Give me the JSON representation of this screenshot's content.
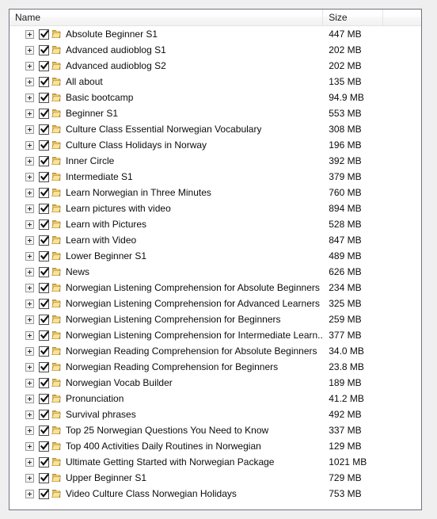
{
  "window": {
    "kind": "file-list-view",
    "accent_folder_color": "#e8c35a",
    "border_color": "#6f7480",
    "background_color": "#efefef",
    "row_background_color": "#ffffff",
    "text_color": "#0c0c0c"
  },
  "columns": [
    {
      "key": "name",
      "label": "Name"
    },
    {
      "key": "size",
      "label": "Size"
    },
    {
      "key": "pad",
      "label": ""
    }
  ],
  "icons": {
    "expander": "plus-square-icon",
    "checkbox": "checkbox-checked-icon",
    "folder": "folder-icon"
  },
  "rows": [
    {
      "name": "Absolute Beginner S1",
      "size": "447 MB",
      "checked": true,
      "expandable": true
    },
    {
      "name": "Advanced audioblog S1",
      "size": "202 MB",
      "checked": true,
      "expandable": true
    },
    {
      "name": "Advanced audioblog S2",
      "size": "202 MB",
      "checked": true,
      "expandable": true
    },
    {
      "name": "All about",
      "size": "135 MB",
      "checked": true,
      "expandable": true
    },
    {
      "name": "Basic bootcamp",
      "size": "94.9 MB",
      "checked": true,
      "expandable": true
    },
    {
      "name": "Beginner S1",
      "size": "553 MB",
      "checked": true,
      "expandable": true
    },
    {
      "name": "Culture Class Essential Norwegian Vocabulary",
      "size": "308 MB",
      "checked": true,
      "expandable": true
    },
    {
      "name": "Culture Class Holidays in Norway",
      "size": "196 MB",
      "checked": true,
      "expandable": true
    },
    {
      "name": "Inner Circle",
      "size": "392 MB",
      "checked": true,
      "expandable": true
    },
    {
      "name": "Intermediate S1",
      "size": "379 MB",
      "checked": true,
      "expandable": true
    },
    {
      "name": "Learn Norwegian in Three Minutes",
      "size": "760 MB",
      "checked": true,
      "expandable": true
    },
    {
      "name": "Learn pictures with video",
      "size": "894 MB",
      "checked": true,
      "expandable": true
    },
    {
      "name": "Learn with Pictures",
      "size": "528 MB",
      "checked": true,
      "expandable": true
    },
    {
      "name": "Learn with Video",
      "size": "847 MB",
      "checked": true,
      "expandable": true
    },
    {
      "name": "Lower Beginner S1",
      "size": "489 MB",
      "checked": true,
      "expandable": true
    },
    {
      "name": "News",
      "size": "626 MB",
      "checked": true,
      "expandable": true
    },
    {
      "name": "Norwegian Listening Comprehension for Absolute Beginners",
      "size": "234 MB",
      "checked": true,
      "expandable": true
    },
    {
      "name": "Norwegian Listening Comprehension for Advanced Learners",
      "size": "325 MB",
      "checked": true,
      "expandable": true
    },
    {
      "name": "Norwegian Listening Comprehension for Beginners",
      "size": "259 MB",
      "checked": true,
      "expandable": true
    },
    {
      "name": "Norwegian Listening Comprehension for Intermediate Learn...",
      "size": "377 MB",
      "checked": true,
      "expandable": true
    },
    {
      "name": "Norwegian Reading Comprehension for Absolute Beginners",
      "size": "34.0 MB",
      "checked": true,
      "expandable": true
    },
    {
      "name": "Norwegian Reading Comprehension for Beginners",
      "size": "23.8 MB",
      "checked": true,
      "expandable": true
    },
    {
      "name": "Norwegian Vocab Builder",
      "size": "189 MB",
      "checked": true,
      "expandable": true
    },
    {
      "name": "Pronunciation",
      "size": "41.2 MB",
      "checked": true,
      "expandable": true
    },
    {
      "name": "Survival phrases",
      "size": "492 MB",
      "checked": true,
      "expandable": true
    },
    {
      "name": "Top 25 Norwegian Questions You Need to Know",
      "size": "337 MB",
      "checked": true,
      "expandable": true
    },
    {
      "name": "Top 400 Activities Daily Routines in Norwegian",
      "size": "129 MB",
      "checked": true,
      "expandable": true
    },
    {
      "name": "Ultimate Getting Started with Norwegian Package",
      "size": "1021 MB",
      "checked": true,
      "expandable": true
    },
    {
      "name": "Upper Beginner S1",
      "size": "729 MB",
      "checked": true,
      "expandable": true
    },
    {
      "name": "Video Culture Class Norwegian Holidays",
      "size": "753 MB",
      "checked": true,
      "expandable": true
    }
  ]
}
